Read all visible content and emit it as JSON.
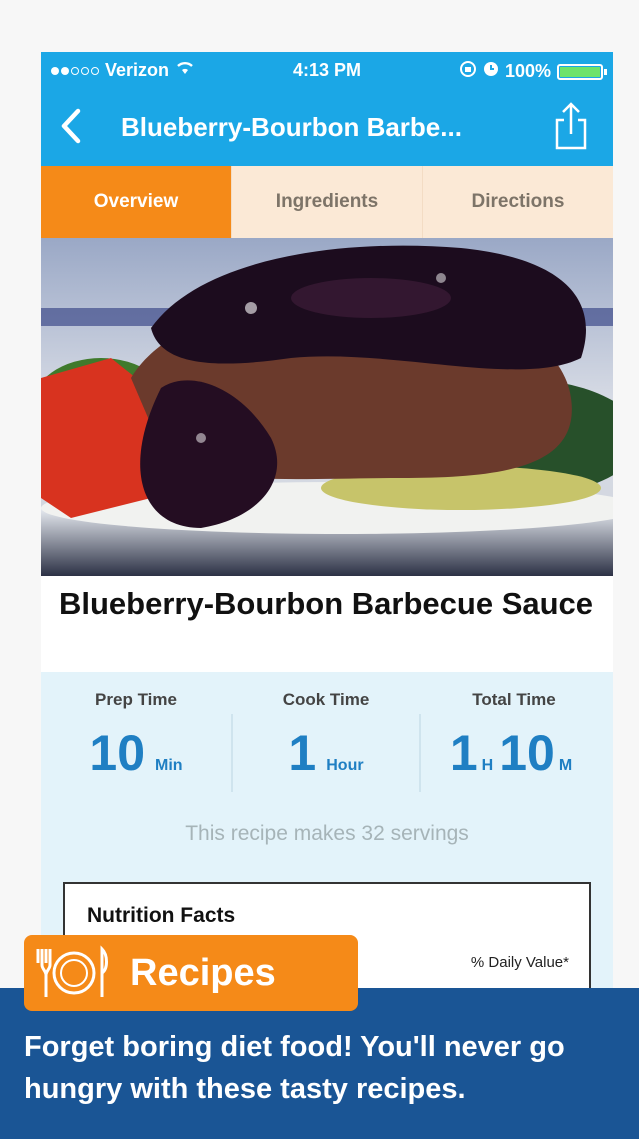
{
  "status_bar": {
    "carrier": "Verizon",
    "time": "4:13 PM",
    "battery": "100%"
  },
  "nav": {
    "title": "Blueberry-Bourbon Barbe..."
  },
  "tabs": [
    {
      "label": "Overview",
      "active": true
    },
    {
      "label": "Ingredients",
      "active": false
    },
    {
      "label": "Directions",
      "active": false
    }
  ],
  "recipe": {
    "title": "Blueberry-Bourbon Barbecue Sauce",
    "prep": {
      "label": "Prep Time",
      "value": "10",
      "unit": "Min"
    },
    "cook": {
      "label": "Cook Time",
      "value": "1",
      "unit": "Hour"
    },
    "total": {
      "label": "Total Time",
      "hours": "1",
      "h_unit": "H",
      "minutes": "10",
      "m_unit": "M"
    },
    "servings": "This recipe makes 32 servings"
  },
  "nutrition": {
    "title": "Nutrition Facts",
    "daily_value": "% Daily Value*"
  },
  "promo": {
    "badge": "Recipes",
    "text": "Forget boring diet food! You'll never go hungry with these tasty recipes."
  },
  "colors": {
    "nav_blue": "#1ba7e6",
    "tab_orange": "#f58a18",
    "banner_blue": "#1a5595",
    "time_blue": "#1f7fc3"
  }
}
